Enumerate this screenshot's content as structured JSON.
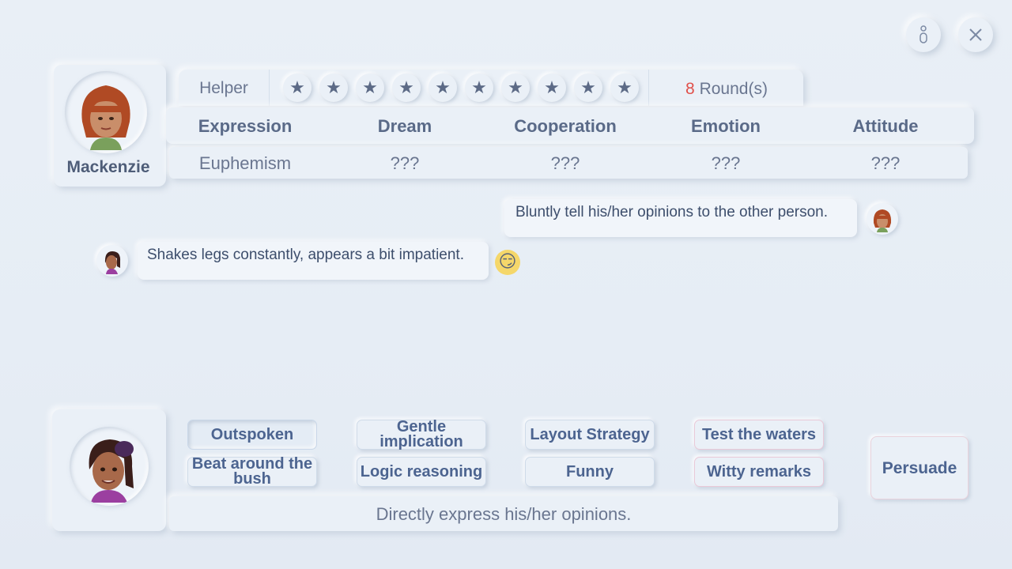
{
  "top_controls": {
    "info_icon": "info-icon",
    "close_icon": "close-icon"
  },
  "npc": {
    "name": "Mackenzie",
    "helper_label": "Helper",
    "stars": [
      1,
      2,
      3,
      4,
      5,
      6,
      7,
      8,
      9,
      10
    ],
    "rounds_count": "8",
    "rounds_label": " Round(s)",
    "attributes": [
      {
        "header": "Expression",
        "value": "Euphemism"
      },
      {
        "header": "Dream",
        "value": "???"
      },
      {
        "header": "Cooperation",
        "value": "???"
      },
      {
        "header": "Emotion",
        "value": "???"
      },
      {
        "header": "Attitude",
        "value": "???"
      }
    ]
  },
  "chat": {
    "npc_message": "Bluntly tell his/her opinions to the other person.",
    "player_message": "Shakes legs constantly, appears a bit impatient.",
    "reaction_emoji": "😏"
  },
  "options": {
    "row1": [
      "Outspoken",
      "Gentle implication",
      "Layout Strategy",
      "Test the waters"
    ],
    "row2": [
      "Beat around the bush",
      "Logic reasoning",
      "Funny",
      "Witty remarks"
    ],
    "persuade_label": "Persuade",
    "description": "Directly express his/her opinions."
  },
  "colors": {
    "accent_red": "#e0504a",
    "button_text": "#4c6490",
    "pink_border": "#e9c9d8"
  }
}
